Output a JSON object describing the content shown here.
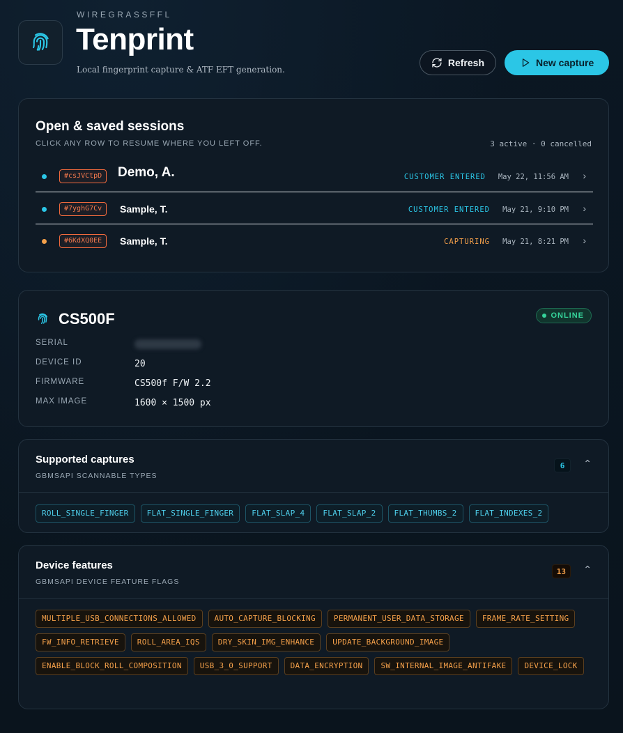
{
  "header": {
    "brand": "WIREGRASSFFL",
    "title": "Tenprint",
    "tagline": "Local fingerprint capture & ATF EFT generation.",
    "refresh_label": "Refresh",
    "new_capture_label": "New capture"
  },
  "sessions": {
    "title": "Open & saved sessions",
    "subtitle": "CLICK ANY ROW TO RESUME WHERE YOU LEFT OFF.",
    "summary": "3 active · 0 cancelled",
    "rows": [
      {
        "id": "#csJVCtpD",
        "name": "Demo, A.",
        "status": "CUSTOMER ENTERED",
        "status_color": "#2bc6e6",
        "dot_color": "#2bc6e6",
        "time": "May 22, 11:56 AM"
      },
      {
        "id": "#7yghG7Cv",
        "name": "Sample, T.",
        "status": "CUSTOMER ENTERED",
        "status_color": "#2bc6e6",
        "dot_color": "#2bc6e6",
        "time": "May 21, 9:10 PM"
      },
      {
        "id": "#6KdXQ0EE",
        "name": "Sample, T.",
        "status": "CAPTURING",
        "status_color": "#f4a04a",
        "dot_color": "#f4a04a",
        "time": "May 21, 8:21 PM"
      }
    ]
  },
  "device": {
    "name": "CS500F",
    "status": "ONLINE",
    "labels": {
      "serial": "SERIAL",
      "device_id": "DEVICE ID",
      "firmware": "FIRMWARE",
      "max_image": "MAX IMAGE"
    },
    "device_id": "20",
    "firmware": "CS500f F/W 2.2",
    "max_image": "1600 × 1500 px"
  },
  "captures": {
    "title": "Supported captures",
    "subtitle": "GBMSAPI SCANNABLE TYPES",
    "count": "6",
    "items": [
      "ROLL_SINGLE_FINGER",
      "FLAT_SINGLE_FINGER",
      "FLAT_SLAP_4",
      "FLAT_SLAP_2",
      "FLAT_THUMBS_2",
      "FLAT_INDEXES_2"
    ]
  },
  "features": {
    "title": "Device features",
    "subtitle": "GBMSAPI DEVICE FEATURE FLAGS",
    "count": "13",
    "items": [
      "MULTIPLE_USB_CONNECTIONS_ALLOWED",
      "AUTO_CAPTURE_BLOCKING",
      "PERMANENT_USER_DATA_STORAGE",
      "FRAME_RATE_SETTING",
      "FW_INFO_RETRIEVE",
      "ROLL_AREA_IQS",
      "DRY_SKIN_IMG_ENHANCE",
      "UPDATE_BACKGROUND_IMAGE",
      "ENABLE_BLOCK_ROLL_COMPOSITION",
      "USB_3_0_SUPPORT",
      "DATA_ENCRYPTION",
      "SW_INTERNAL_IMAGE_ANTIFAKE",
      "DEVICE_LOCK"
    ]
  },
  "colors": {
    "accent": "#2bc6e6",
    "warning": "#f4a04a",
    "online": "#35d39a",
    "id_tag": "#f26a3d"
  }
}
